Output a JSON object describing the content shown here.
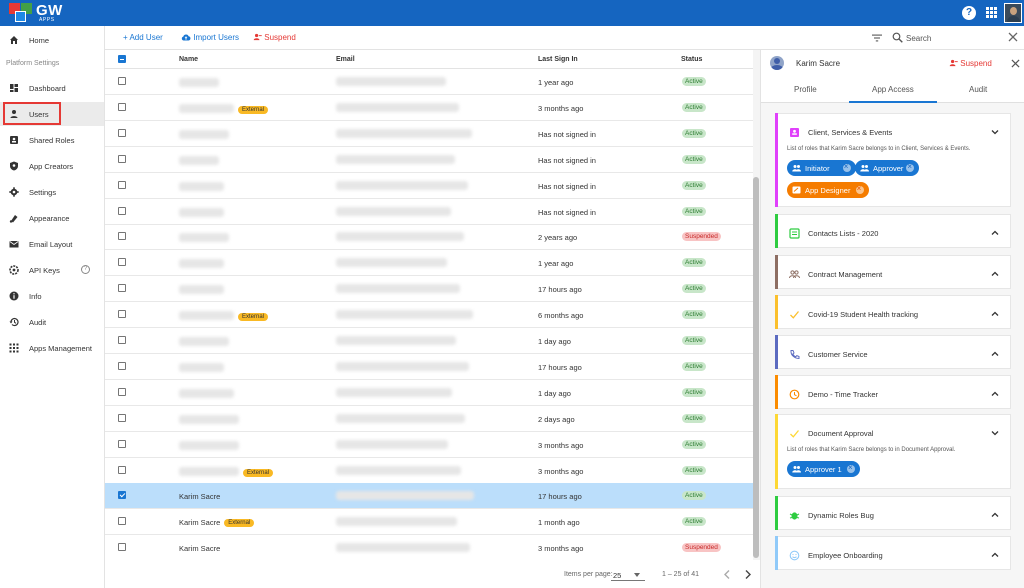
{
  "app": {
    "logo_text": "GW",
    "logo_sub": "APPS"
  },
  "sidebar": {
    "section_label": "Platform Settings",
    "items": [
      {
        "label": "Home",
        "icon": "home-icon"
      },
      {
        "label": "Dashboard",
        "icon": "dashboard-icon"
      },
      {
        "label": "Users",
        "icon": "person-icon"
      },
      {
        "label": "Shared Roles",
        "icon": "roles-icon"
      },
      {
        "label": "App Creators",
        "icon": "shield-icon"
      },
      {
        "label": "Settings",
        "icon": "gear-icon"
      },
      {
        "label": "Appearance",
        "icon": "palette-icon"
      },
      {
        "label": "Email Layout",
        "icon": "mail-icon"
      },
      {
        "label": "API Keys",
        "icon": "api-icon"
      },
      {
        "label": "Info",
        "icon": "info-icon"
      },
      {
        "label": "Audit",
        "icon": "history-icon"
      },
      {
        "label": "Apps Management",
        "icon": "apps-icon"
      }
    ]
  },
  "toolbar": {
    "add_user": "+ Add User",
    "import_users": "Import Users",
    "suspend": "Suspend",
    "search_placeholder": "Search"
  },
  "table": {
    "headers": {
      "name": "Name",
      "email": "Email",
      "last_sign_in": "Last Sign In",
      "status": "Status"
    },
    "rows": [
      {
        "name": "",
        "badge": "",
        "last_sign_in": "1 year ago",
        "status": "Active",
        "checked": false,
        "selected": false
      },
      {
        "name": "",
        "badge": "External",
        "last_sign_in": "3 months ago",
        "status": "Active",
        "checked": false,
        "selected": false
      },
      {
        "name": "",
        "badge": "",
        "last_sign_in": "Has not signed in",
        "status": "Active",
        "checked": false,
        "selected": false
      },
      {
        "name": "",
        "badge": "",
        "last_sign_in": "Has not signed in",
        "status": "Active",
        "checked": false,
        "selected": false
      },
      {
        "name": "",
        "badge": "",
        "last_sign_in": "Has not signed in",
        "status": "Active",
        "checked": false,
        "selected": false
      },
      {
        "name": "",
        "badge": "",
        "last_sign_in": "Has not signed in",
        "status": "Active",
        "checked": false,
        "selected": false
      },
      {
        "name": "",
        "badge": "",
        "last_sign_in": "2 years ago",
        "status": "Suspended",
        "checked": false,
        "selected": false
      },
      {
        "name": "",
        "badge": "",
        "last_sign_in": "1 year ago",
        "status": "Active",
        "checked": false,
        "selected": false
      },
      {
        "name": "",
        "badge": "",
        "last_sign_in": "17 hours ago",
        "status": "Active",
        "checked": false,
        "selected": false
      },
      {
        "name": "",
        "badge": "External",
        "last_sign_in": "6 months ago",
        "status": "Active",
        "checked": false,
        "selected": false
      },
      {
        "name": "",
        "badge": "",
        "last_sign_in": "1 day ago",
        "status": "Active",
        "checked": false,
        "selected": false
      },
      {
        "name": "",
        "badge": "",
        "last_sign_in": "17 hours ago",
        "status": "Active",
        "checked": false,
        "selected": false
      },
      {
        "name": "",
        "badge": "",
        "last_sign_in": "1 day ago",
        "status": "Active",
        "checked": false,
        "selected": false
      },
      {
        "name": "",
        "badge": "",
        "last_sign_in": "2 days ago",
        "status": "Active",
        "checked": false,
        "selected": false
      },
      {
        "name": "",
        "badge": "",
        "last_sign_in": "3 months ago",
        "status": "Active",
        "checked": false,
        "selected": false
      },
      {
        "name": "",
        "badge": "External",
        "last_sign_in": "3 months ago",
        "status": "Active",
        "checked": false,
        "selected": false
      },
      {
        "name": "Karim Sacre",
        "badge": "",
        "last_sign_in": "17 hours ago",
        "status": "Active",
        "checked": true,
        "selected": true
      },
      {
        "name": "Karim Sacre",
        "badge": "External",
        "last_sign_in": "1 month ago",
        "status": "Active",
        "checked": false,
        "selected": false
      },
      {
        "name": "Karim Sacre",
        "badge": "",
        "last_sign_in": "3 months ago",
        "status": "Suspended",
        "checked": false,
        "selected": false
      }
    ]
  },
  "pagination": {
    "label": "Items per page:",
    "per_page": "25",
    "range": "1 – 25 of 41"
  },
  "panel": {
    "user_name": "Karim Sacre",
    "suspend": "Suspend",
    "tabs": [
      "Profile",
      "App Access",
      "Audit"
    ],
    "cards": [
      {
        "title": "Client, Services & Events",
        "color": "#e040fb",
        "icon": "contacts-icon",
        "expanded": true,
        "desc": "List of roles that Karim Sacre belongs to in Client, Services & Events.",
        "chips": [
          {
            "label": "Initiator",
            "color": "blue"
          },
          {
            "label": "Approver",
            "color": "blue"
          },
          {
            "label": "App Designer",
            "color": "orange"
          }
        ]
      },
      {
        "title": "Contacts Lists - 2020",
        "color": "#2ecc40",
        "icon": "list-icon",
        "expanded": false
      },
      {
        "title": "Contract Management",
        "color": "#8d6e63",
        "icon": "group-icon",
        "expanded": false
      },
      {
        "title": "Covid-19 Student Health tracking",
        "color": "#fbc02d",
        "icon": "check-icon",
        "expanded": false
      },
      {
        "title": "Customer Service",
        "color": "#5c6bc0",
        "icon": "phone-icon",
        "expanded": false
      },
      {
        "title": "Demo - Time Tracker",
        "color": "#fb8c00",
        "icon": "clock-icon",
        "expanded": false
      },
      {
        "title": "Document Approval",
        "color": "#fdd835",
        "icon": "check-icon",
        "expanded": true,
        "desc": "List of roles that Karim Sacre belongs to in Document Approval.",
        "chips": [
          {
            "label": "Approver 1",
            "color": "blue"
          }
        ]
      },
      {
        "title": "Dynamic Roles Bug",
        "color": "#2ecc40",
        "icon": "bug-icon",
        "expanded": false
      },
      {
        "title": "Employee Onboarding",
        "color": "#90caf9",
        "icon": "smile-icon",
        "expanded": false
      }
    ]
  },
  "colors": {
    "topbar": "#1565c0",
    "accent": "#1976d2",
    "danger": "#e53935",
    "active_badge": "#c8e6c9",
    "suspended_badge": "#f8c4c4",
    "external_badge": "#f9b924"
  }
}
